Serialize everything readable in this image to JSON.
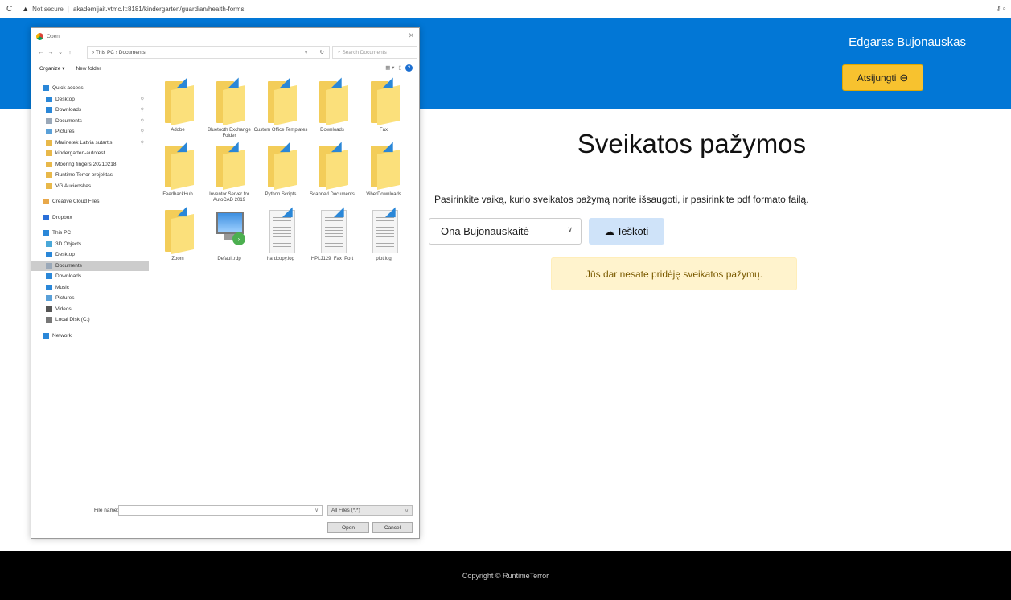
{
  "browser": {
    "security_text": "Not secure",
    "url": "akademijait.vtmc.lt:8181/kindergarten/guardian/health-forms"
  },
  "header": {
    "user_name": "Edgaras Bujonauskas",
    "logout_label": "Atsijungti",
    "bg_color": "#0277d6",
    "button_color": "#f7c22f"
  },
  "main": {
    "title": "Sveikatos pažymos",
    "instruction": "Pasirinkite vaiką, kurio sveikatos pažymą norite išsaugoti, ir pasirinkite pdf formato failą.",
    "child_select_value": "Ona Bujonauskaitė",
    "search_label": "Ieškoti",
    "alert_text": "Jūs dar nesate pridėję sveikatos pažymų."
  },
  "footer": {
    "copyright": "Copyright © RuntimeTerror"
  },
  "dialog": {
    "title": "Open",
    "path": "› This PC › Documents",
    "search_placeholder": "Search Documents",
    "organize_label": "Organize ▾",
    "new_folder_label": "New folder",
    "nav_items": [
      {
        "label": "Quick access",
        "icon": "star-icon",
        "pinned": false,
        "selected": false,
        "indent": 0
      },
      {
        "label": "Desktop",
        "icon": "desktop-icon",
        "pinned": true,
        "selected": false,
        "indent": 1
      },
      {
        "label": "Downloads",
        "icon": "download-icon",
        "pinned": true,
        "selected": false,
        "indent": 1
      },
      {
        "label": "Documents",
        "icon": "document-icon",
        "pinned": true,
        "selected": false,
        "indent": 1
      },
      {
        "label": "Pictures",
        "icon": "picture-icon",
        "pinned": true,
        "selected": false,
        "indent": 1
      },
      {
        "label": "Marinetek Latvia sutartis",
        "icon": "folder-icon",
        "pinned": true,
        "selected": false,
        "indent": 1
      },
      {
        "label": "kindergarten-autotest",
        "icon": "folder-icon",
        "pinned": false,
        "selected": false,
        "indent": 1
      },
      {
        "label": "Mooring fingers 20210218",
        "icon": "folder-icon",
        "pinned": false,
        "selected": false,
        "indent": 1
      },
      {
        "label": "Runtime Terror projektas",
        "icon": "folder-icon",
        "pinned": false,
        "selected": false,
        "indent": 1
      },
      {
        "label": "VG Aucienskes",
        "icon": "folder-icon",
        "pinned": false,
        "selected": false,
        "indent": 1
      },
      {
        "label": "Creative Cloud Files",
        "icon": "cloud-folder-icon",
        "pinned": false,
        "selected": false,
        "indent": 0
      },
      {
        "label": "Dropbox",
        "icon": "dropbox-icon",
        "pinned": false,
        "selected": false,
        "indent": 0
      },
      {
        "label": "This PC",
        "icon": "pc-icon",
        "pinned": false,
        "selected": false,
        "indent": 0
      },
      {
        "label": "3D Objects",
        "icon": "cube-icon",
        "pinned": false,
        "selected": false,
        "indent": 1
      },
      {
        "label": "Desktop",
        "icon": "desktop-icon",
        "pinned": false,
        "selected": false,
        "indent": 1
      },
      {
        "label": "Documents",
        "icon": "document-icon",
        "pinned": false,
        "selected": true,
        "indent": 1
      },
      {
        "label": "Downloads",
        "icon": "download-icon",
        "pinned": false,
        "selected": false,
        "indent": 1
      },
      {
        "label": "Music",
        "icon": "music-icon",
        "pinned": false,
        "selected": false,
        "indent": 1
      },
      {
        "label": "Pictures",
        "icon": "picture-icon",
        "pinned": false,
        "selected": false,
        "indent": 1
      },
      {
        "label": "Videos",
        "icon": "video-icon",
        "pinned": false,
        "selected": false,
        "indent": 1
      },
      {
        "label": "Local Disk (C:)",
        "icon": "disk-icon",
        "pinned": false,
        "selected": false,
        "indent": 1
      },
      {
        "label": "Network",
        "icon": "network-icon",
        "pinned": false,
        "selected": false,
        "indent": 0
      }
    ],
    "files": [
      {
        "name": "Adobe",
        "kind": "folder"
      },
      {
        "name": "Bluetooth Exchange Folder",
        "kind": "folder"
      },
      {
        "name": "Custom Office Templates",
        "kind": "folder"
      },
      {
        "name": "Downloads",
        "kind": "folder"
      },
      {
        "name": "Fax",
        "kind": "folder"
      },
      {
        "name": "FeedbackHub",
        "kind": "folder"
      },
      {
        "name": "Inventor Server for AutoCAD 2019",
        "kind": "folder"
      },
      {
        "name": "Python Scripts",
        "kind": "folder"
      },
      {
        "name": "Scanned Documents",
        "kind": "folder"
      },
      {
        "name": "ViberDownloads",
        "kind": "folder"
      },
      {
        "name": "Zoom",
        "kind": "folder"
      },
      {
        "name": "Default.rdp",
        "kind": "rdp"
      },
      {
        "name": "hardcopy.log",
        "kind": "doc"
      },
      {
        "name": "HPLJ129_Fax_Port",
        "kind": "doc"
      },
      {
        "name": "plot.log",
        "kind": "doc"
      }
    ],
    "file_name_label": "File name:",
    "file_name_value": "",
    "file_type": "All Files (*.*)",
    "open_label": "Open",
    "cancel_label": "Cancel"
  }
}
